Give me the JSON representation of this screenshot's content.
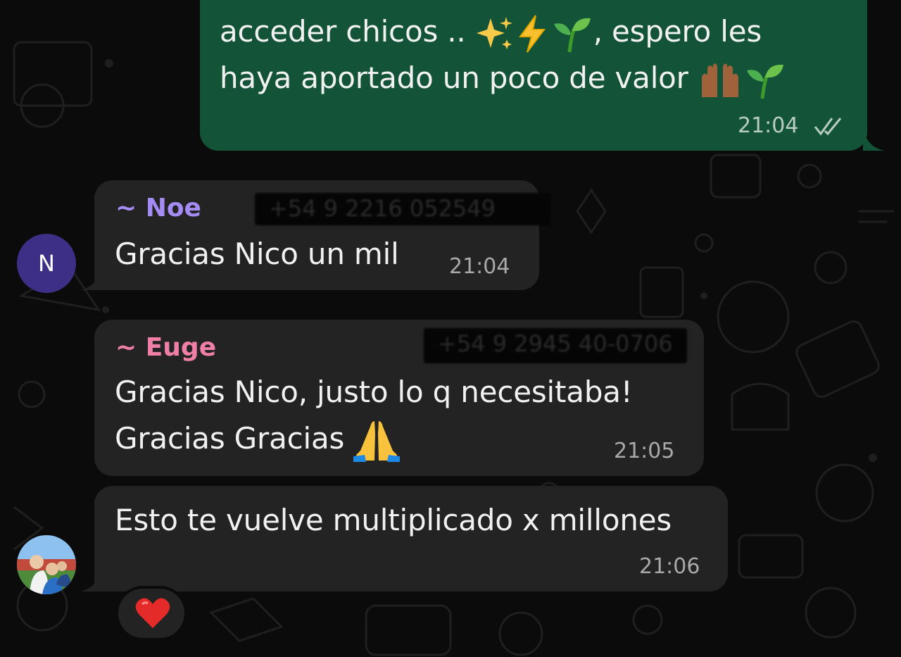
{
  "messages": {
    "outgoing": {
      "line1": "acceder chicos .. ",
      "line1_tail": ", espero les",
      "line2": "haya aportado un poco de valor",
      "time": "21:04",
      "status_icon": "double-check-icon"
    },
    "noe": {
      "sender": "~ Noe",
      "phone": "+54 9 2216 052549",
      "text": "Gracias Nico un mil",
      "time": "21:04",
      "avatar_letter": "N"
    },
    "euge": {
      "sender": "~ Euge",
      "phone": "+54 9 2945 40-0706",
      "line1": "Gracias Nico, justo lo q necesitaba!",
      "line2": "Gracias Gracias ",
      "time": "21:05"
    },
    "euge2": {
      "text": "Esto te vuelve multiplicado x millones",
      "time": "21:06",
      "reaction": "heart-icon"
    }
  },
  "colors": {
    "outgoing_bubble": "#135438",
    "incoming_bubble": "#232323",
    "noe_name": "#a58cf4",
    "euge_name": "#f07fa8",
    "avatar_bg": "#3d2f86"
  }
}
